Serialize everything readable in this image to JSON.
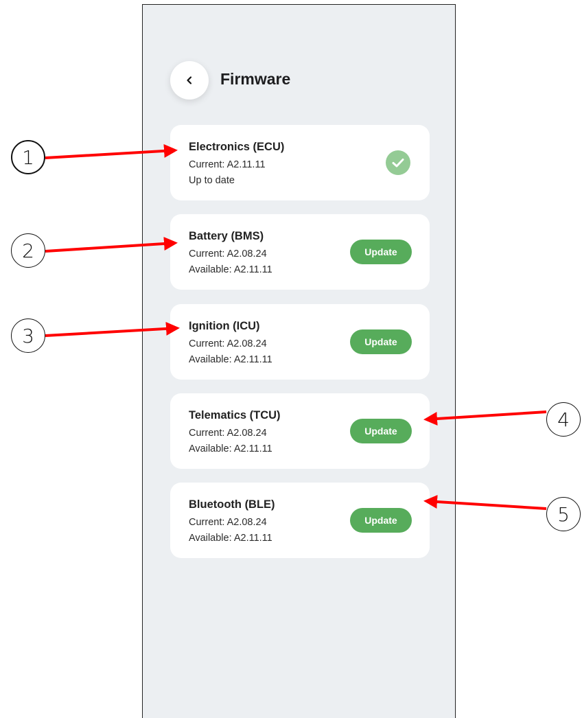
{
  "header": {
    "title": "Firmware"
  },
  "cards": [
    {
      "name": "Electronics (ECU)",
      "line1": "Current: A2.11.11",
      "line2": "Up to date",
      "status": "up-to-date"
    },
    {
      "name": "Battery (BMS)",
      "line1": "Current: A2.08.24",
      "line2": "Available: A2.11.11",
      "action": "Update"
    },
    {
      "name": "Ignition (ICU)",
      "line1": "Current: A2.08.24",
      "line2": "Available: A2.11.11",
      "action": "Update"
    },
    {
      "name": "Telematics (TCU)",
      "line1": "Current: A2.08.24",
      "line2": "Available: A2.11.11",
      "action": "Update"
    },
    {
      "name": "Bluetooth (BLE)",
      "line1": "Current: A2.08.24",
      "line2": "Available: A2.11.11",
      "action": "Update"
    }
  ],
  "callouts": [
    "1",
    "2",
    "3",
    "4",
    "5"
  ],
  "colors": {
    "background": "#eceff2",
    "card": "#ffffff",
    "update_button": "#57ac5b",
    "check_badge": "#94cb95",
    "arrow": "#ff0000"
  },
  "icons": {
    "back": "chevron-left-icon",
    "up_to_date": "check-icon"
  }
}
